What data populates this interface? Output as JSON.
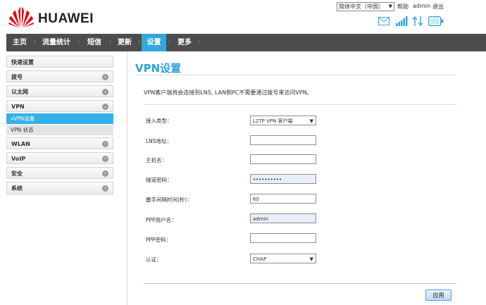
{
  "header": {
    "brand": "HUAWEI",
    "language": "简体中文（中国）",
    "help": "帮助",
    "user": "admin",
    "logout": "退出"
  },
  "status_icons": [
    "mail-icon",
    "signal-icon",
    "data-transfer-icon",
    "battery-icon"
  ],
  "nav": [
    "主页",
    "流量统计",
    "短信",
    "更新",
    "设置",
    "更多"
  ],
  "nav_active": "设置",
  "sidebar": {
    "quick": "快速设置",
    "dial": "拨号",
    "ethernet": "以太网",
    "vpn": "VPN",
    "vpn_settings": "»VPN设置",
    "vpn_status": "VPN 状态",
    "wlan": "WLAN",
    "voip": "VoIP",
    "security": "安全",
    "system": "系统"
  },
  "main": {
    "title": "VPN设置",
    "description": "VPN客户端将会连接到LNS, LAN侧PC不需要通过拨号来访问VPN。",
    "fields": {
      "access_type": {
        "label": "接入类型：",
        "value": "L2TP VPN 客户端"
      },
      "lns_address": {
        "label": "LNS地址：",
        "value": ""
      },
      "hostname": {
        "label": "主机名：",
        "value": ""
      },
      "tunnel_password": {
        "label": "隧道密码：",
        "value": "••••••••••"
      },
      "hello_interval": {
        "label": "握手间隔时间(秒)：",
        "value": "60"
      },
      "ppp_username": {
        "label": "PPP用户名：",
        "value": "admin"
      },
      "ppp_password": {
        "label": "PPP密码：",
        "value": ""
      },
      "auth": {
        "label": "认证：",
        "value": "CHAP"
      }
    },
    "apply": "应用"
  },
  "colors": {
    "accent": "#32a7dc",
    "navbar": "#4d4d4d",
    "brand_red": "#e60012"
  }
}
